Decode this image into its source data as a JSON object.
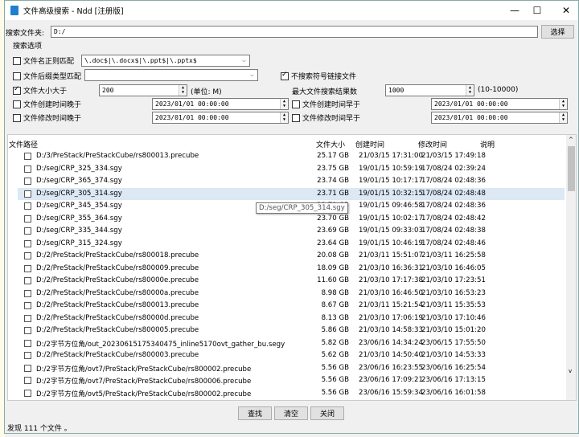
{
  "window": {
    "title": "文件高级搜索 - Ndd [注册版]",
    "minimize": "—",
    "maximize": "☐",
    "close": "✕"
  },
  "folder": {
    "label": "搜索文件夹:",
    "value": "D:/",
    "choose": "选择"
  },
  "options": {
    "group": "搜索选项",
    "regex": {
      "label": "文件名正则匹配",
      "checked": false,
      "value": "\\.doc$|\\.docx$|\\.ppt$|\\.pptx$"
    },
    "suffix": {
      "label": "文件后缀类型匹配",
      "checked": false,
      "value": ""
    },
    "nosymlink": {
      "label": "不搜索符号链接文件",
      "checked": true
    },
    "size": {
      "label": "文件大小大于",
      "checked": true,
      "value": "200",
      "unit": "(单位: M)"
    },
    "maxres": {
      "label": "最大文件搜索结果数",
      "value": "1000",
      "range": "(10-10000)"
    },
    "createdAfter": {
      "label": "文件创建时间晚于",
      "checked": false,
      "value": "2023/01/01 00:00:00"
    },
    "createdBefore": {
      "label": "文件创建时间早于",
      "checked": false,
      "value": "2023/01/01 00:00:00"
    },
    "modifiedAfter": {
      "label": "文件修改时间晚于",
      "checked": false,
      "value": "2023/01/01 00:00:00"
    },
    "modifiedBefore": {
      "label": "文件修改时间早于",
      "checked": false,
      "value": "2023/01/01 00:00:00"
    }
  },
  "table": {
    "headers": {
      "path": "文件路径",
      "size": "文件大小",
      "created": "创建时间",
      "modified": "修改时间",
      "note": "说明"
    },
    "tooltip": "D:/seg/CRP_305_314.sgy",
    "rows": [
      [
        "D:/3/PreStack/PreStackCube/rs800013.precube",
        "25.17 GB",
        "21/03/15 17:31:00",
        "21/03/15 17:49:18"
      ],
      [
        "D:/seg/CRP_325_334.sgy",
        "23.75 GB",
        "19/01/15 10:59:19",
        "17/08/24 02:39:24"
      ],
      [
        "D:/seg/CRP_365_374.sgy",
        "23.74 GB",
        "19/01/15 10:17:17",
        "17/08/24 02:48:36"
      ],
      [
        "D:/seg/CRP_305_314.sgy",
        "23.71 GB",
        "19/01/15 10:32:15",
        "17/08/24 02:48:48"
      ],
      [
        "D:/seg/CRP_345_354.sgy",
        "23.71 GB",
        "19/01/15 09:46:58",
        "17/08/24 02:48:36"
      ],
      [
        "D:/seg/CRP_355_364.sgy",
        "23.70 GB",
        "19/01/15 10:02:17",
        "17/08/24 02:48:42"
      ],
      [
        "D:/seg/CRP_335_344.sgy",
        "23.69 GB",
        "19/01/15 09:33:03",
        "17/08/24 02:48:38"
      ],
      [
        "D:/seg/CRP_315_324.sgy",
        "23.64 GB",
        "19/01/15 10:46:19",
        "17/08/24 02:48:46"
      ],
      [
        "D:/2/PreStack/PreStackCube/rs800018.precube",
        "20.08 GB",
        "21/03/11 15:51:07",
        "21/03/11 16:25:58"
      ],
      [
        "D:/2/PreStack/PreStackCube/rs800009.precube",
        "18.09 GB",
        "21/03/10 16:36:31",
        "21/03/10 16:46:05"
      ],
      [
        "D:/2/PreStack/PreStackCube/rs80000e.precube",
        "11.60 GB",
        "21/03/10 17:17:38",
        "21/03/10 17:23:51"
      ],
      [
        "D:/2/PreStack/PreStackCube/rs80000a.precube",
        "8.98 GB",
        "21/03/10 16:46:50",
        "21/03/10 16:53:23"
      ],
      [
        "D:/2/PreStack/PreStackCube/rs800013.precube",
        "8.67 GB",
        "21/03/11 15:21:54",
        "21/03/11 15:35:53"
      ],
      [
        "D:/2/PreStack/PreStackCube/rs80000d.precube",
        "8.13 GB",
        "21/03/10 17:06:19",
        "21/03/10 17:10:46"
      ],
      [
        "D:/2/PreStack/PreStackCube/rs800005.precube",
        "5.86 GB",
        "21/03/10 14:58:33",
        "21/03/10 15:01:20"
      ],
      [
        "D:/2字节方位角/out_20230615175340475_inline5170ovt_gather_bu.segy",
        "5.82 GB",
        "23/06/16 14:34:24",
        "23/06/15 17:55:50"
      ],
      [
        "D:/2/PreStack/PreStackCube/rs800003.precube",
        "5.62 GB",
        "21/03/10 14:50:40",
        "21/03/10 14:53:33"
      ],
      [
        "D:/2字节方位角/ovt7/PreStack/PreStackCube/rs800002.precube",
        "5.56 GB",
        "23/06/16 16:23:55",
        "23/06/16 16:25:54"
      ],
      [
        "D:/2字节方位角/ovt7/PreStack/PreStackCube/rs800006.precube",
        "5.56 GB",
        "23/06/16 17:09:21",
        "23/06/16 17:13:15"
      ],
      [
        "D:/2字节方位角/ovt5/PreStack/PreStackCube/rs800002.precube",
        "5.56 GB",
        "23/06/16 15:59:34",
        "23/06/16 16:01:58"
      ]
    ]
  },
  "buttons": {
    "find": "查找",
    "clear": "清空",
    "close": "关闭"
  },
  "status": "发现 111 个文件 。"
}
